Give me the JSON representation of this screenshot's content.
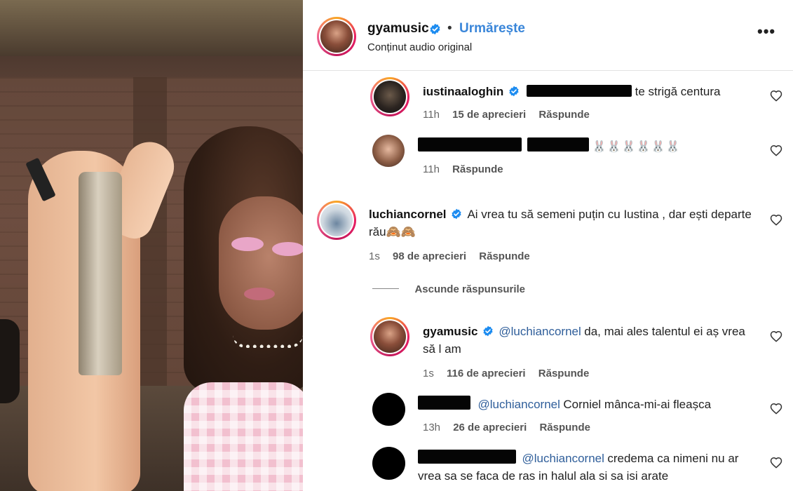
{
  "post": {
    "username": "gyamusic",
    "follow_label": "Urmărește",
    "audio_label": "Conținut audio original",
    "more_label": "•••"
  },
  "comments": [
    {
      "username": "iustinaaloghin",
      "text": "te strigă centura",
      "time": "11h",
      "likes": "15 de aprecieri",
      "reply_label": "Răspunde"
    },
    {
      "username": "",
      "emoji": "🐰🐰🐰🐰🐰🐰",
      "time": "11h",
      "reply_label": "Răspunde"
    },
    {
      "username": "luchiancornel",
      "text": "Ai vrea tu să semeni puțin cu Iustina , dar ești departe rău🙈🙈",
      "time": "1s",
      "likes": "98 de aprecieri",
      "reply_label": "Răspunde"
    },
    {
      "hide_replies_label": "Ascunde răspunsurile"
    },
    {
      "username": "gyamusic",
      "mention": "@luchiancornel",
      "text": "da, mai ales talentul ei aș vrea să l am",
      "time": "1s",
      "likes": "116 de aprecieri",
      "reply_label": "Răspunde"
    },
    {
      "mention": "@luchiancornel",
      "text": "Corniel mânca-mi-ai fleașca",
      "time": "13h",
      "likes": "26 de aprecieri",
      "reply_label": "Răspunde"
    },
    {
      "mention": "@luchiancornel",
      "text": "credema ca nimeni nu ar vrea sa se faca de ras in halul ala si sa isi arate"
    }
  ],
  "colors": {
    "accent_blue": "#3a86d9",
    "verified_blue": "#1d8cf0",
    "mention_blue": "#2f5e9a"
  }
}
